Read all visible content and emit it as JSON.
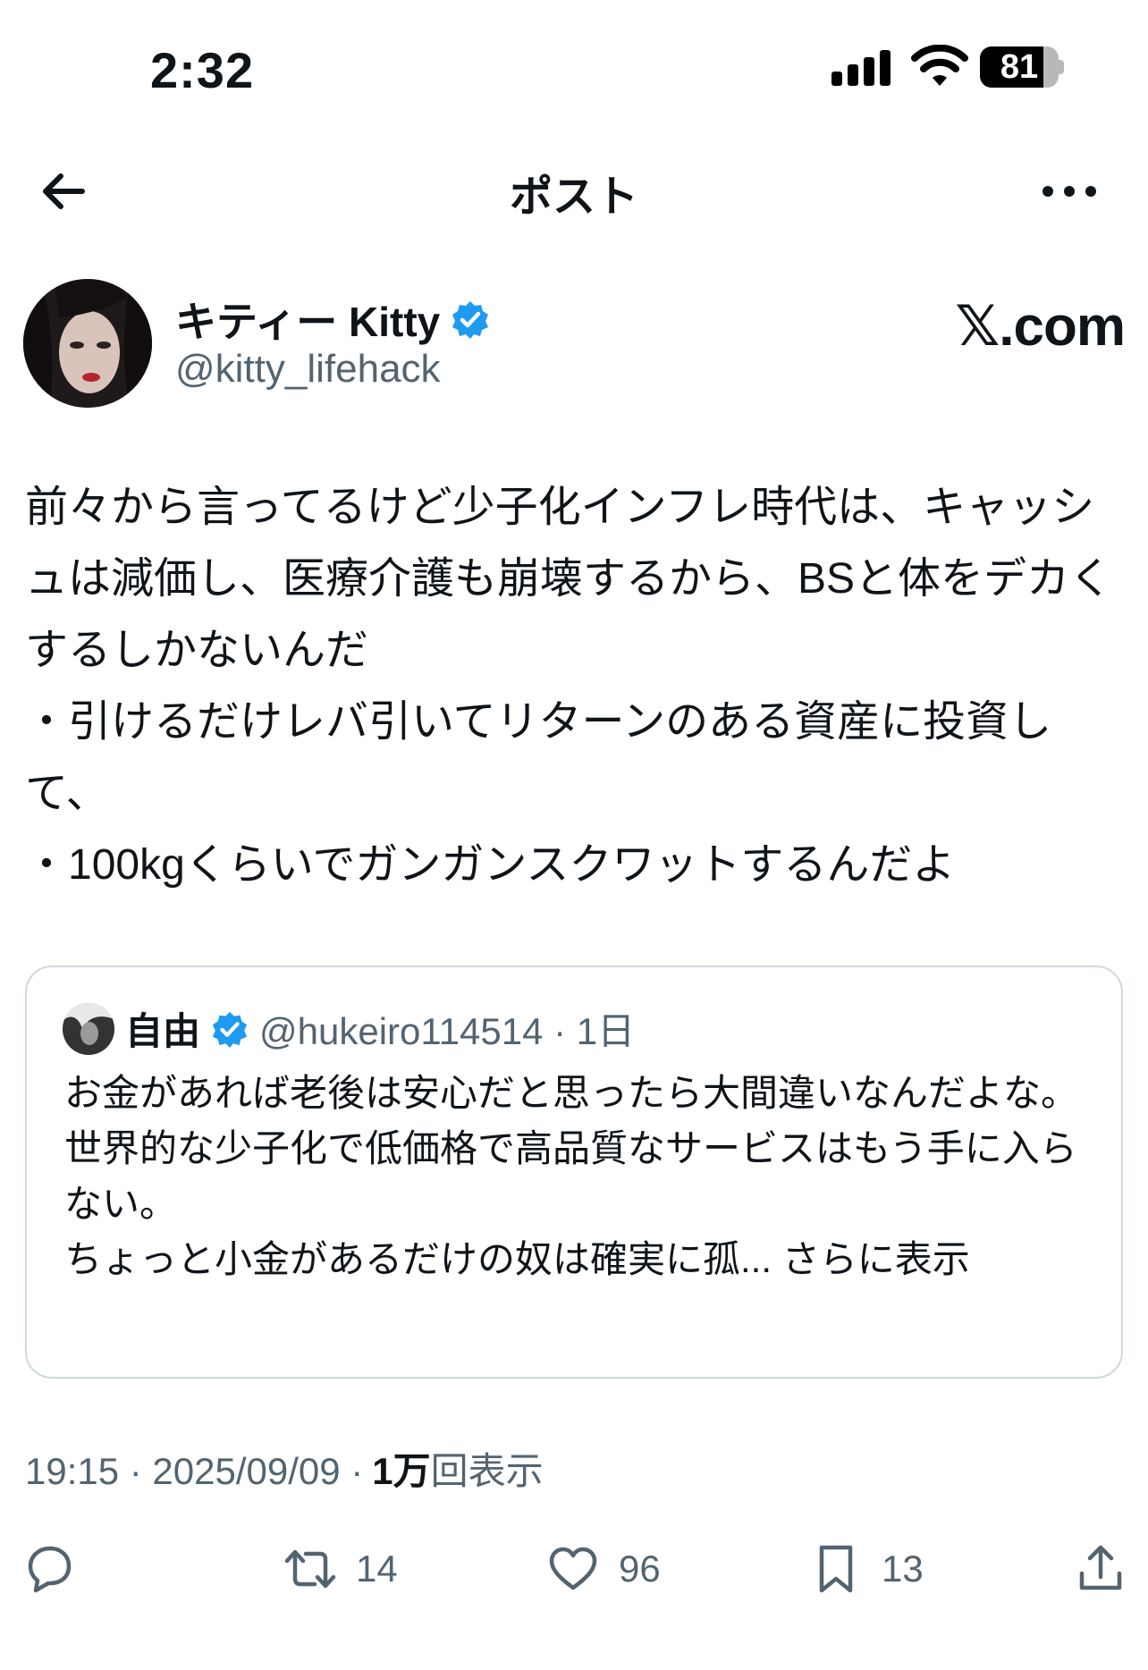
{
  "status_bar": {
    "time": "2:32",
    "battery": "81",
    "battery_level": 0.81
  },
  "nav": {
    "title": "ポスト"
  },
  "author": {
    "name": "キティー Kitty",
    "handle": "@kitty_lifehack",
    "verified": true,
    "watermark": "𝕏.com"
  },
  "tweet": {
    "text": "前々から言ってるけど少子化インフレ時代は、キャッシュは減価し、医療介護も崩壊するから、BSと体をデカくするしかないんだ\n・引けるだけレバ引いてリターンのある資産に投資して、\n・100kgくらいでガンガンスクワットするんだよ"
  },
  "quote": {
    "name": "自由",
    "handle": "@hukeiro114514 · 1日",
    "verified": true,
    "text": "お金があれば老後は安心だと思ったら大間違いなんだよな。\n世界的な少子化で低価格で高品質なサービスはもう手に入らない。\nちょっと小金があるだけの奴は確実に孤... ",
    "show_more": "さらに表示"
  },
  "meta": {
    "time_date": "19:15 · 2025/09/09 ·",
    "views_count": "1万",
    "views_label": "回表示"
  },
  "actions": {
    "reply": {
      "icon": "reply-icon",
      "count": ""
    },
    "retweet": {
      "icon": "retweet-icon",
      "count": "14"
    },
    "like": {
      "icon": "heart-icon",
      "count": "96"
    },
    "bookmark": {
      "icon": "bookmark-icon",
      "count": "13"
    },
    "share": {
      "icon": "share-icon",
      "count": ""
    }
  },
  "colors": {
    "text": "#0f1419",
    "secondary": "#536471",
    "verified": "#1d9bf0",
    "border": "#cfd9de"
  }
}
